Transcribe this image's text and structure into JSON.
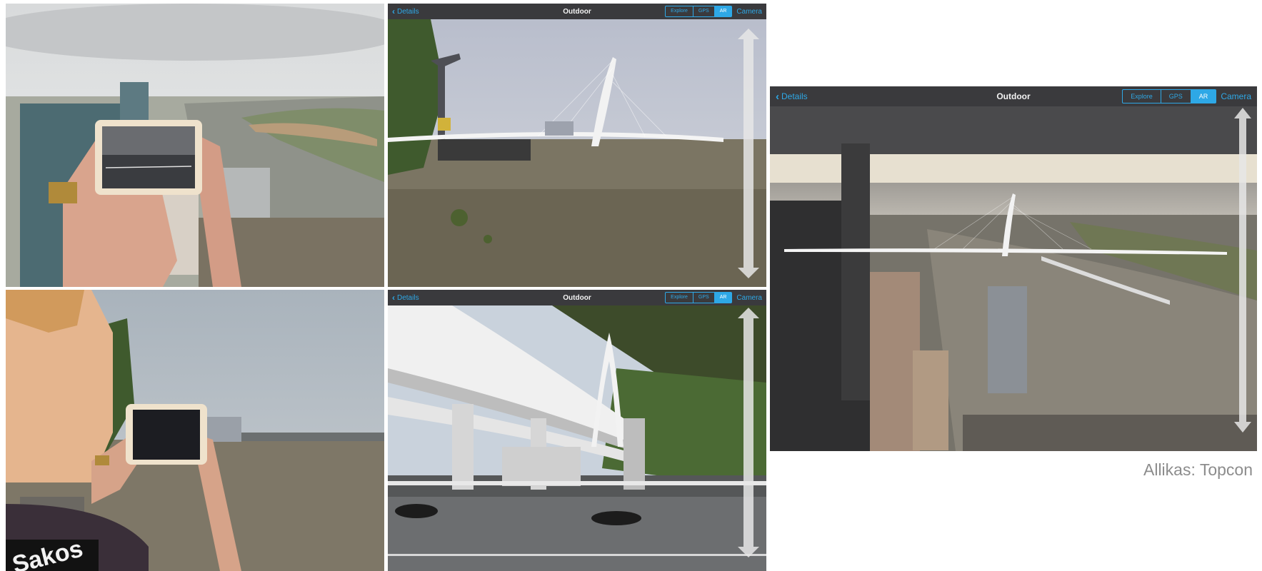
{
  "panels": {
    "top_middle": {
      "app": {
        "back_label": "Details",
        "title": "Outdoor",
        "modes": [
          "Explore",
          "GPS",
          "AR"
        ],
        "active_mode": "AR",
        "camera_label": "Camera"
      }
    },
    "bottom_middle": {
      "app": {
        "back_label": "Details",
        "title": "Outdoor",
        "modes": [
          "Explore",
          "GPS",
          "AR"
        ],
        "active_mode": "AR",
        "camera_label": "Camera"
      }
    },
    "right": {
      "app": {
        "back_label": "Details",
        "title": "Outdoor",
        "modes": [
          "Explore",
          "GPS",
          "AR"
        ],
        "active_mode": "AR",
        "camera_label": "Camera"
      }
    }
  },
  "shirt_text": "Sakos",
  "credit": "Allikas: Topcon",
  "colors": {
    "accent": "#2ea8e6",
    "toolbar": "#3a3a3d",
    "credit_text": "#8c8c8c"
  }
}
